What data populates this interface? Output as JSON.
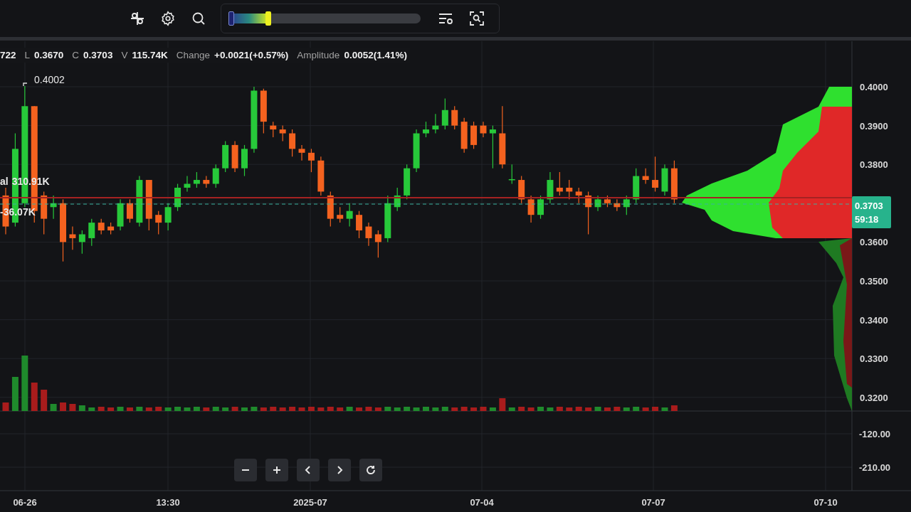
{
  "toolbar": {
    "tools": [
      {
        "kind": "move"
      },
      {
        "kind": "settings"
      },
      {
        "kind": "search"
      }
    ],
    "zoom_slider": {
      "level": 0.2
    },
    "actions": [
      {
        "kind": "list-settings"
      },
      {
        "kind": "zoom-fit"
      }
    ]
  },
  "legend": [
    {
      "value": "722"
    },
    {
      "label": "L",
      "value": "0.3670"
    },
    {
      "label": "C",
      "value": "0.3703"
    },
    {
      "label": "V",
      "value": "115.74K"
    },
    {
      "label": "Change",
      "value": "+0.0021(+0.57%)"
    },
    {
      "label": "Amplitude",
      "value": "0.0052(1.41%)"
    }
  ],
  "high_marker": "0.4002",
  "indicator_labels": [
    {
      "label": "al",
      "value": "310.91K"
    },
    {
      "value": "-36.07K"
    }
  ],
  "price_axis": [
    "0.4000",
    "0.3900",
    "0.3800",
    "0.3600",
    "0.3500",
    "0.3400",
    "0.3300",
    "0.3200"
  ],
  "volume_axis": [
    "-120.00",
    "-210.00"
  ],
  "current_price": {
    "price": "0.3703",
    "countdown": "59:18"
  },
  "time_axis": [
    "06-26",
    "13:30",
    "2025-07",
    "07-04",
    "07-07",
    "07-10"
  ],
  "controls": [
    {
      "kind": "zoom-out"
    },
    {
      "kind": "zoom-in"
    },
    {
      "kind": "back"
    },
    {
      "kind": "forward"
    },
    {
      "kind": "reset"
    }
  ]
}
